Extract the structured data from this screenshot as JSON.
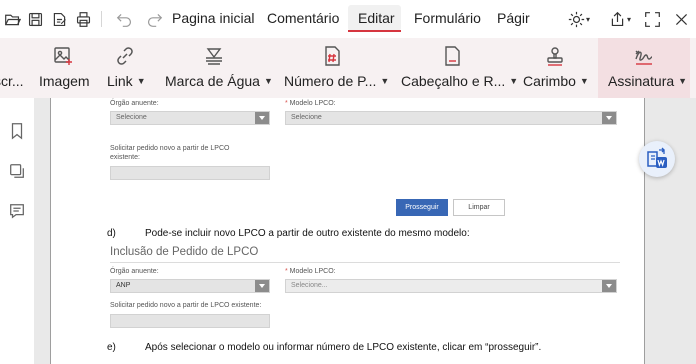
{
  "menu": {
    "tabs": [
      {
        "label": "Pagina inicial"
      },
      {
        "label": "Comentário"
      },
      {
        "label": "Editar",
        "active": true
      },
      {
        "label": "Formulário"
      },
      {
        "label": "Págir"
      }
    ],
    "accent_color": "#d6363f"
  },
  "ribbon": {
    "partial_left_label": "scr...",
    "items": [
      {
        "label": "Imagem",
        "icon": "image-add-icon"
      },
      {
        "label": "Link",
        "icon": "link-icon",
        "dropdown": true
      },
      {
        "label": "Marca de Água",
        "icon": "watermark-icon",
        "dropdown": true
      },
      {
        "label": "Número de P...",
        "icon": "page-number-icon",
        "dropdown": true
      },
      {
        "label": "Cabeçalho e R...",
        "icon": "header-footer-icon",
        "dropdown": true
      },
      {
        "label": "Carimbo",
        "icon": "stamp-icon",
        "dropdown": true
      },
      {
        "label": "Assinatura",
        "icon": "signature-icon",
        "dropdown": true,
        "selected": true
      }
    ]
  },
  "document": {
    "form1": {
      "orgao_label": "Órgão anuente:",
      "orgao_value": "Selecione",
      "modelo_req": "*",
      "modelo_label": " Modelo LPCO:",
      "modelo_value": "Selecione",
      "solicitar_label_1": "Solicitar pedido novo a partir de LPCO",
      "solicitar_label_2": "existente:",
      "prosseguir": "Prosseguir",
      "limpar": "Limpar"
    },
    "para_d_marker": "d)",
    "para_d_text": "Pode-se incluir novo LPCO a partir de outro existente do mesmo modelo:",
    "section_title": "Inclusão de Pedido de LPCO",
    "form2": {
      "orgao_label": "Órgão anuente:",
      "orgao_value": "ANP",
      "modelo_req": "*",
      "modelo_label": " Modelo LPCO:",
      "modelo_value": "Selecione...",
      "solicitar_label": "Solicitar pedido novo a partir de LPCO existente:"
    },
    "para_e_marker": "e)",
    "para_e_text": "Após selecionar o modelo ou informar número de LPCO existente, clicar em “prosseguir”."
  }
}
